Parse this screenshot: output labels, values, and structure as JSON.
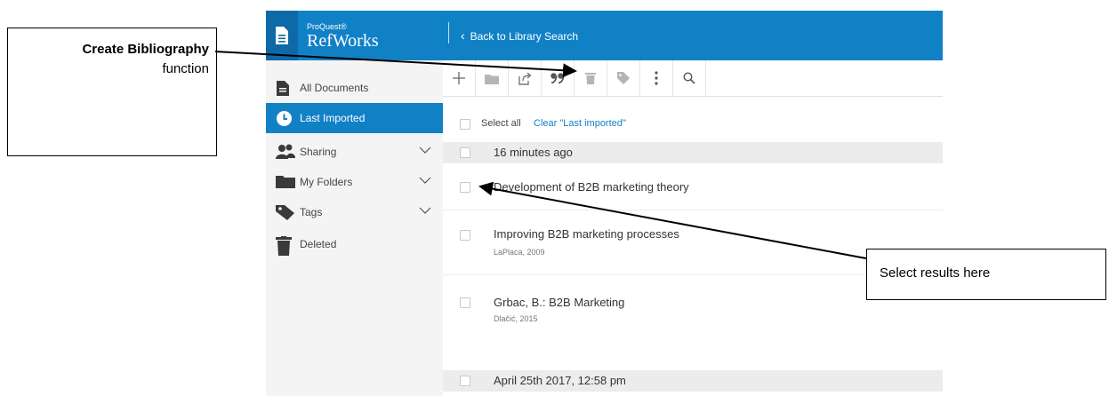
{
  "brand": {
    "small": "ProQuest®",
    "name": "RefWorks"
  },
  "topbar": {
    "back_label": "Back to Library Search"
  },
  "sidebar": {
    "items": [
      {
        "label": "All Documents",
        "icon": "document-icon"
      },
      {
        "label": "Last Imported",
        "icon": "clock-icon",
        "active": true
      },
      {
        "label": "Sharing",
        "icon": "people-icon",
        "expandable": true
      },
      {
        "label": "My Folders",
        "icon": "folder-icon",
        "expandable": true
      },
      {
        "label": "Tags",
        "icon": "tag-icon",
        "expandable": true
      },
      {
        "label": "Deleted",
        "icon": "trash-icon"
      }
    ]
  },
  "toolbar": {
    "tools": [
      "add-icon",
      "folder-icon",
      "share-icon",
      "quote-icon",
      "trash-icon",
      "tag-icon",
      "more-vertical-icon",
      "search-icon"
    ]
  },
  "select": {
    "select_all": "Select all",
    "clear_label": "Clear \"Last imported\""
  },
  "groups": [
    {
      "header": "16 minutes ago",
      "references": [
        {
          "title": "Development of B2B marketing theory",
          "meta": ""
        },
        {
          "title": "Improving B2B marketing processes",
          "meta": "LaPlaca, 2009"
        },
        {
          "title": "Grbac, B.: B2B Marketing",
          "meta": "Dlačić, 2015"
        }
      ]
    },
    {
      "header": "April 25th 2017, 12:58 pm",
      "references": []
    }
  ],
  "annotations": {
    "bibliography": {
      "bold": "Create Bibliography",
      "normal": "function"
    },
    "select_results": "Select results here"
  },
  "colors": {
    "accent": "#1181c6",
    "accent_dark": "#0d69a7",
    "sidebar_bg": "#f4f4f4"
  }
}
